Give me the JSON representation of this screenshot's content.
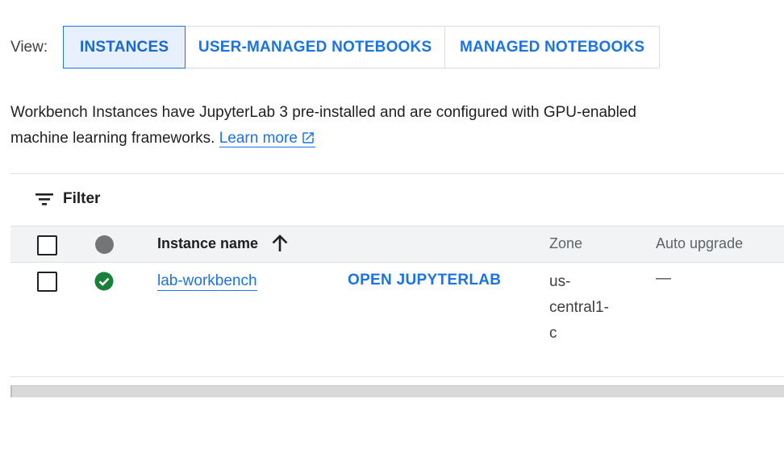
{
  "view": {
    "label": "View:",
    "tabs": [
      {
        "label": "INSTANCES",
        "active": true
      },
      {
        "label": "USER-MANAGED NOTEBOOKS",
        "active": false
      },
      {
        "label": "MANAGED NOTEBOOKS",
        "active": false
      }
    ]
  },
  "description": {
    "text": "Workbench Instances have JupyterLab 3 pre-installed and are configured with GPU-enabled machine learning frameworks.",
    "link": "Learn more",
    "link_icon": "open-in-new-icon"
  },
  "filter": {
    "label": "Filter",
    "icon": "filter-list-icon"
  },
  "table": {
    "headers": {
      "status_icon": "status-indicator-icon",
      "name": "Instance name",
      "sort_icon": "arrow-upward-icon",
      "zone": "Zone",
      "auto_upgrade": "Auto upgrade"
    },
    "rows": [
      {
        "status_icon": "check-circle-icon",
        "status_color": "#188038",
        "name": "lab-workbench",
        "action": "OPEN JUPYTERLAB",
        "zone_lines": [
          "us-",
          "central1-",
          "c"
        ],
        "auto_upgrade": "—"
      }
    ]
  },
  "colors": {
    "accent": "#1a73e8",
    "active_bg": "#e8f0fe",
    "success": "#188038"
  }
}
